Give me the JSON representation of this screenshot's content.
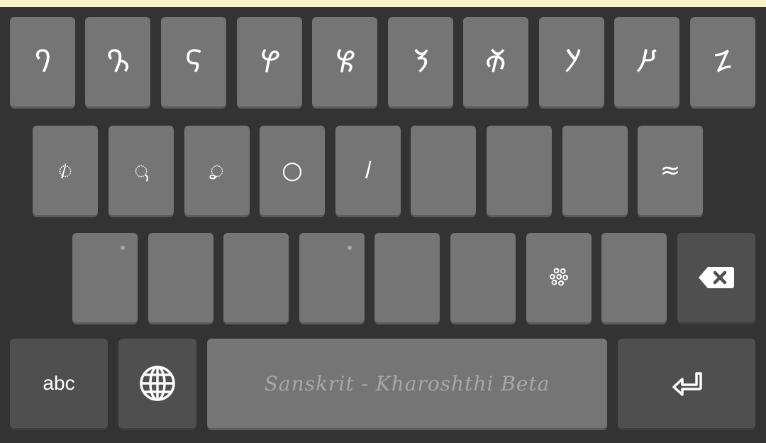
{
  "row1": {
    "keys": [
      {
        "name": "key-kharoshthi-a",
        "glyph": "𐨀"
      },
      {
        "name": "key-kharoshthi-ka",
        "glyph": "𐨐"
      },
      {
        "name": "key-kharoshthi-kha",
        "glyph": "𐨑"
      },
      {
        "name": "key-kharoshthi-ga",
        "glyph": "𐨒"
      },
      {
        "name": "key-kharoshthi-gha",
        "glyph": "𐨓"
      },
      {
        "name": "key-kharoshthi-ca",
        "glyph": "𐨕"
      },
      {
        "name": "key-kharoshthi-cha",
        "glyph": "𐨖"
      },
      {
        "name": "key-kharoshthi-ja",
        "glyph": "𐨗"
      },
      {
        "name": "key-kharoshthi-nya",
        "glyph": "𐨙"
      },
      {
        "name": "key-kharoshthi-ta",
        "glyph": "𐨚"
      }
    ]
  },
  "row2": {
    "keys": [
      {
        "name": "key-vowel-sign-i",
        "glyph": "𐨁"
      },
      {
        "name": "key-vowel-sign-vocalic-length",
        "glyph": "𐨌"
      },
      {
        "name": "key-vowel-sign-u",
        "glyph": "𐨂"
      },
      {
        "name": "key-ring",
        "glyph": "○"
      },
      {
        "name": "key-symbol",
        "glyph": "𐩖"
      },
      {
        "name": "key-blank-1",
        "glyph": ""
      },
      {
        "name": "key-blank-2",
        "glyph": ""
      },
      {
        "name": "key-blank-3",
        "glyph": ""
      },
      {
        "name": "key-approx",
        "glyph": "≈"
      }
    ]
  },
  "row3": {
    "keys": [
      {
        "name": "key-blank-4",
        "glyph": ""
      },
      {
        "name": "key-blank-5",
        "glyph": ""
      },
      {
        "name": "key-blank-6",
        "glyph": ""
      },
      {
        "name": "key-blank-7",
        "glyph": ""
      },
      {
        "name": "key-blank-8",
        "glyph": ""
      },
      {
        "name": "key-blank-9",
        "glyph": ""
      },
      {
        "name": "key-flower-punctuation",
        "glyph": "𐩕"
      },
      {
        "name": "key-blank-10",
        "glyph": ""
      }
    ]
  },
  "bottom": {
    "abc_label": "abc",
    "space_label": "Sanskrit - Kharoshthi Beta"
  },
  "icons": {
    "backspace": "backspace-icon",
    "globe": "globe-icon",
    "enter": "enter-icon"
  },
  "colors": {
    "key": "#757575",
    "key_dark": "#4f4f4f",
    "background": "#333333",
    "top_strip": "#fcf4c4"
  }
}
